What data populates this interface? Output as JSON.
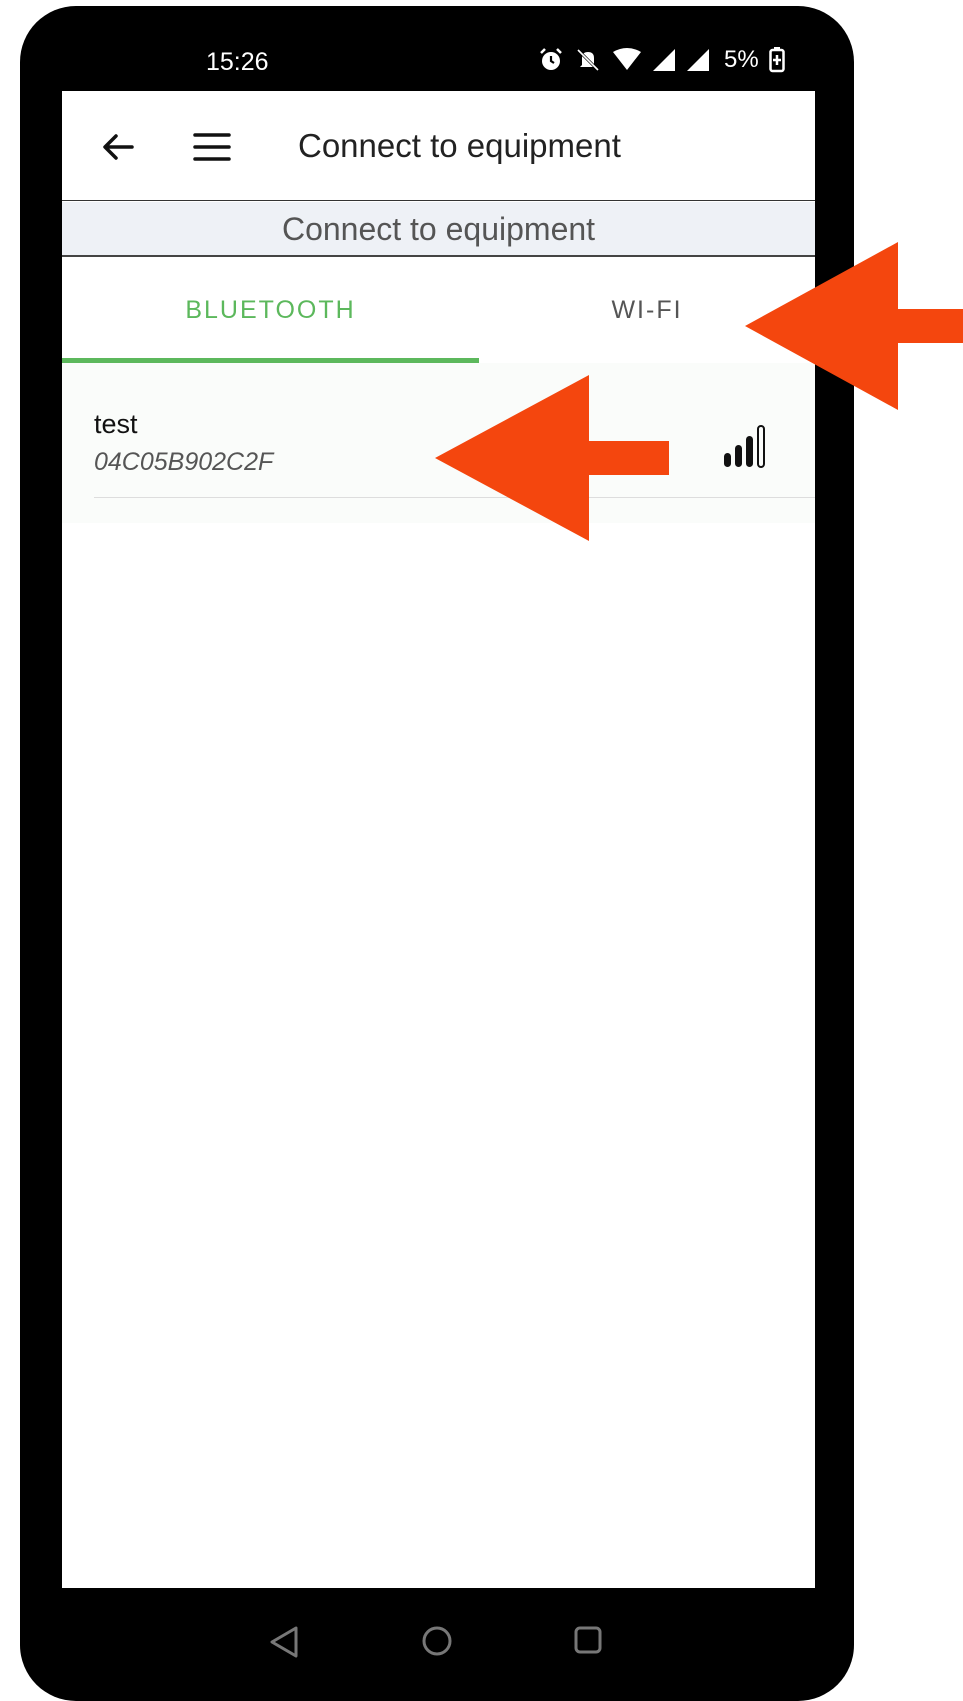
{
  "status_bar": {
    "time": "15:26",
    "battery_text": "5%",
    "icons": [
      "alarm-icon",
      "do-not-disturb-icon",
      "wifi-icon",
      "cell-signal-icon",
      "cell-signal-icon",
      "battery-charging-icon"
    ]
  },
  "app_bar": {
    "title": "Connect to equipment",
    "back_icon": "arrow-left-icon",
    "menu_icon": "hamburger-menu-icon"
  },
  "subheader": {
    "text": "Connect to equipment"
  },
  "tabs": [
    {
      "label": "BLUETOOTH",
      "selected": true
    },
    {
      "label": "WI-FI",
      "selected": false
    }
  ],
  "devices": [
    {
      "name": "test",
      "address": "04C05B902C2F",
      "signal_icon": "signal-strength-icon",
      "signal_level": 3,
      "signal_max": 4
    }
  ],
  "nav_bar": {
    "icons": [
      "nav-back-icon",
      "nav-home-icon",
      "nav-recents-icon"
    ]
  },
  "annotations": {
    "arrow_color": "#f4460e",
    "arrows": [
      "arrow-pointing-to-wifi-tab",
      "arrow-pointing-to-device-item"
    ]
  },
  "colors": {
    "accent": "#5cb85c",
    "subheader_bg": "#eef1f6"
  }
}
